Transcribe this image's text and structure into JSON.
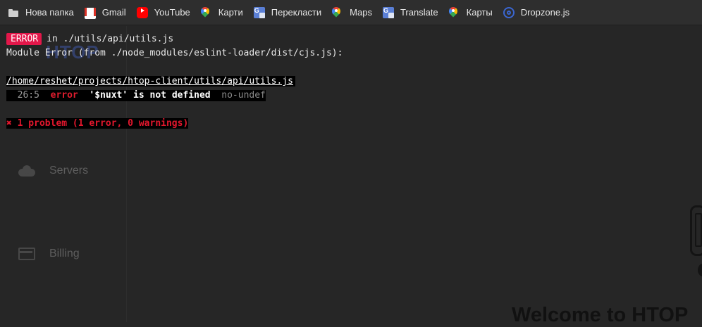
{
  "bookmarks": [
    {
      "label": "Нова папка",
      "icon": "folder-icon"
    },
    {
      "label": "Gmail",
      "icon": "gmail-icon"
    },
    {
      "label": "YouTube",
      "icon": "youtube-icon"
    },
    {
      "label": "Карти",
      "icon": "maps-icon"
    },
    {
      "label": "Перекласти",
      "icon": "translate-icon"
    },
    {
      "label": "Maps",
      "icon": "maps-icon"
    },
    {
      "label": "Translate",
      "icon": "translate-icon"
    },
    {
      "label": "Карты",
      "icon": "maps-icon"
    },
    {
      "label": "Dropzone.js",
      "icon": "dropzone-icon"
    }
  ],
  "app": {
    "brand": "HTOP",
    "nav": [
      {
        "label": "Servers",
        "icon": "cloud-icon"
      },
      {
        "label": "Billing",
        "icon": "credit-card-icon"
      }
    ],
    "welcome": "Welcome to HTOP"
  },
  "error": {
    "badge": "ERROR",
    "location": "in ./utils/api/utils.js",
    "module_error": "Module Error (from ./node_modules/eslint-loader/dist/cjs.js):",
    "file_path": "/home/reshet/projects/htop-client/utils/api/utils.js",
    "position": "26:5",
    "severity": "error",
    "message": "'$nuxt' is not defined",
    "rule": "no-undef",
    "summary": "✖ 1 problem (1 error, 0 warnings)"
  },
  "colors": {
    "badge": "#e3174a",
    "error_text": "#e3172d",
    "background": "#262626"
  }
}
